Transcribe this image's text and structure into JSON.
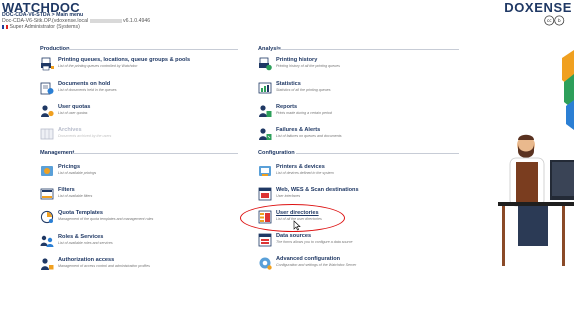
{
  "header": {
    "logo_text": "WATCHDOC",
    "brand_right": "DOXENSE",
    "title": "DOC-CDA-V6-STDA > Main menu",
    "subline_prefix": "Doc-CDA-V6-Sitk.OP.(vdoxense.local",
    "subline_version": "v6.1.0.4946",
    "role": "Super Administrator (Systems)"
  },
  "sections": {
    "production": {
      "title": "Production",
      "items": [
        {
          "title": "Printing queues, locations, queue groups & pools",
          "sub": "List of the printing queues controlled by Watchdoc",
          "icon": "printer-queue-icon",
          "disabled": false
        },
        {
          "title": "Documents on hold",
          "sub": "List of documents held in the queues",
          "icon": "held-documents-icon",
          "disabled": false
        },
        {
          "title": "User quotas",
          "sub": "List of user quotas",
          "icon": "user-quota-icon",
          "disabled": false
        },
        {
          "title": "Archives",
          "sub": "Documents archived by the users",
          "icon": "archives-icon",
          "disabled": true
        }
      ]
    },
    "analysis": {
      "title": "Analysis",
      "items": [
        {
          "title": "Printing history",
          "sub": "Printing history of all the printing queues",
          "icon": "printing-history-icon",
          "disabled": false
        },
        {
          "title": "Statistics",
          "sub": "Statistics of all the printing queues",
          "icon": "statistics-icon",
          "disabled": false
        },
        {
          "title": "Reports",
          "sub": "Prints made during a certain period",
          "icon": "reports-icon",
          "disabled": false
        },
        {
          "title": "Failures & Alerts",
          "sub": "List of failures on queues and documents",
          "icon": "failures-alerts-icon",
          "disabled": false
        }
      ]
    },
    "management": {
      "title": "Management",
      "items": [
        {
          "title": "Pricings",
          "sub": "List of available pricings",
          "icon": "pricings-icon",
          "disabled": false
        },
        {
          "title": "Filters",
          "sub": "List of available filters",
          "icon": "filters-icon",
          "disabled": false
        },
        {
          "title": "Quota Templates",
          "sub": "Management of the quota templates and management rules",
          "icon": "quota-templates-icon",
          "disabled": false
        },
        {
          "title": "Roles & Services",
          "sub": "List of available roles and services",
          "icon": "roles-services-icon",
          "disabled": false
        },
        {
          "title": "Authorization access",
          "sub": "Management of access control and administration profiles",
          "icon": "authorization-icon",
          "disabled": false
        }
      ]
    },
    "configuration": {
      "title": "Configuration",
      "items": [
        {
          "title": "Printers & devices",
          "sub": "List of devices defined in the system",
          "icon": "printers-devices-icon",
          "disabled": false
        },
        {
          "title": "Web, WES & Scan destinations",
          "sub": "User interfaces",
          "icon": "web-wes-scan-icon",
          "disabled": false
        },
        {
          "title": "User directories",
          "sub": "List of all the user directories",
          "icon": "user-directories-icon",
          "disabled": false
        },
        {
          "title": "Data sources",
          "sub": "The forms allows you to configure a data source",
          "icon": "data-sources-icon",
          "disabled": false
        },
        {
          "title": "Advanced configuration",
          "sub": "Configuration and settings of the Watchdoc Server",
          "icon": "advanced-config-icon",
          "disabled": false
        }
      ]
    }
  },
  "colors": {
    "brand_navy": "#1f3864",
    "accent_orange": "#f0a020",
    "accent_green": "#2d9f5a",
    "highlight_red": "#dd1111"
  }
}
